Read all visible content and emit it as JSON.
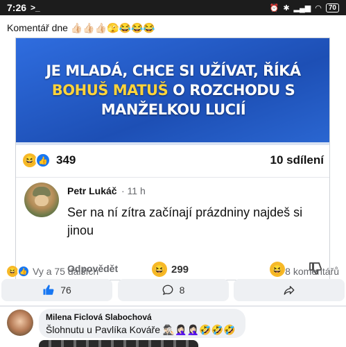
{
  "statusbar": {
    "time": "7:26",
    "terminal_icon": ">_",
    "battery": "70"
  },
  "post": {
    "caption": "Komentář dne 👍🏻👍🏻👍🏻🫣😂😂😂",
    "banner": {
      "line1": "JE MLADÁ, CHCE SI UŽÍVAT, ŘÍKÁ",
      "line2_highlight": "BOHUŠ MATUŠ",
      "line2_rest": " O ROZCHODU S",
      "line3": "MANŽELKOU LUCIÍ"
    },
    "reactions_count": "349",
    "shares": "10 sdílení",
    "top_comment": {
      "author": "Petr Lukáč",
      "time": "· 11 h",
      "text": "Ser na ní zítra začínají prázdniny najdeš si jinou",
      "reply_label": "Odpovědět",
      "reaction_count": "299"
    },
    "meta": {
      "reactors": "Vy a 75 dalších",
      "comments": "8 komentářů"
    },
    "actions": {
      "like_count": "76",
      "comment_count": "8"
    }
  },
  "next_comment": {
    "author": "Milena Ficlová Slabochová",
    "text": "Šlohnutu u Pavlíka Kováře 🕵🏻‍♂️🤦🏻‍♀️🤦🏻‍♀️🤣🤣🤣"
  },
  "colors": {
    "accent": "#1877f2",
    "banner_blue": "#2a66d1",
    "banner_yellow": "#ffd43b"
  }
}
